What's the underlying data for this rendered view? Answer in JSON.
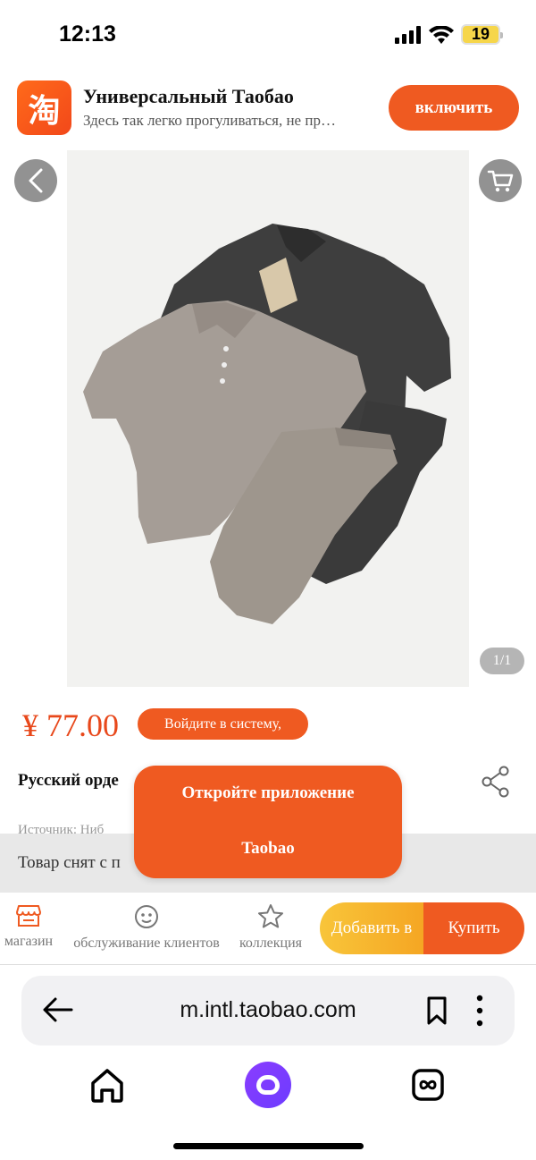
{
  "status_bar": {
    "time": "12:13",
    "battery": "19",
    "icons": [
      "signal-icon",
      "wifi-icon",
      "battery-icon"
    ]
  },
  "app_banner": {
    "logo_glyph": "淘",
    "title": "Универсальный Таобао",
    "subtitle": "Здесь так легко прогуливаться, не пр…",
    "enable_label": "включить"
  },
  "gallery": {
    "page_counter": "1/1"
  },
  "product": {
    "price": "¥ 77.00",
    "login_label": "Войдите в систему,",
    "title": "Русский орде",
    "source": "Источник: Ниб"
  },
  "notice": {
    "removed_text": "Товар снят с п                                          -нибудь еще ~"
  },
  "popup": {
    "line1": "Откройте приложение",
    "line2": "Taobao"
  },
  "action_bar": {
    "store_label": "магазин",
    "service_label": "обслуживание клиентов",
    "favorite_label": "коллекция",
    "add_label": "Добавить в",
    "buy_label": "Купить"
  },
  "browser": {
    "url": "m.intl.taobao.com"
  },
  "colors": {
    "accent": "#ef5a21",
    "price": "#e8481b",
    "add_gradient_start": "#f8c53a",
    "add_gradient_end": "#f5a623",
    "alice": "#7a3cff"
  }
}
